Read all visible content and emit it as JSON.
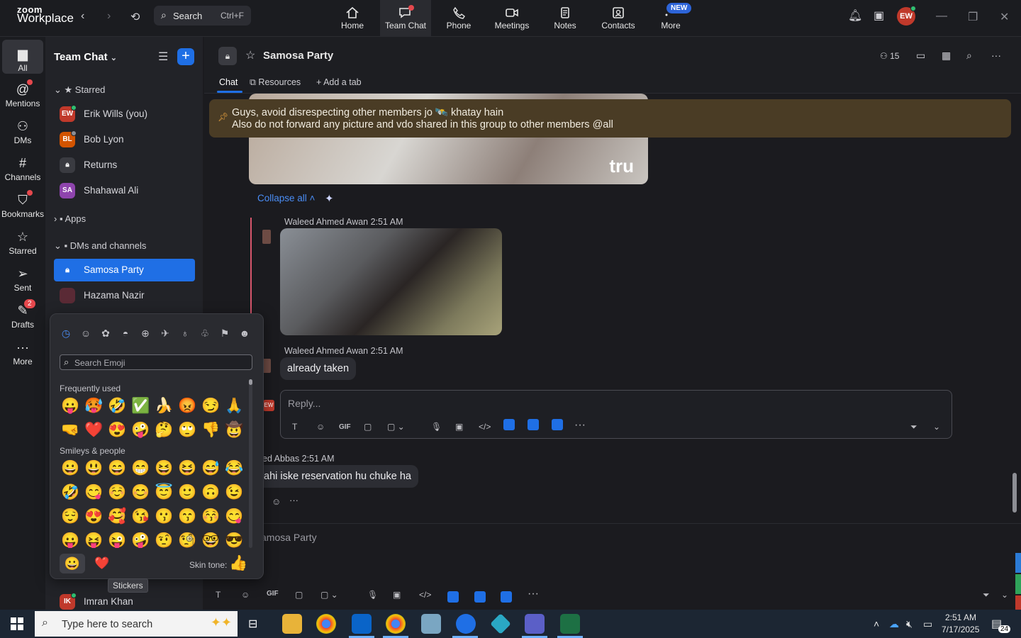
{
  "app": {
    "logo_top": "zoom",
    "logo_bottom": "Workplace",
    "search_label": "Search",
    "search_shortcut": "Ctrl+F",
    "nav": [
      "Home",
      "Team Chat",
      "Phone",
      "Meetings",
      "Notes",
      "Contacts",
      "More"
    ],
    "new_badge": "NEW",
    "avatar_initials": "EW"
  },
  "rail": {
    "items": [
      "All",
      "Mentions",
      "DMs",
      "Channels",
      "Bookmarks",
      "Starred",
      "Sent",
      "Drafts",
      "More"
    ],
    "drafts_badge": "2"
  },
  "sidebar": {
    "title": "Team Chat",
    "sections": {
      "starred": "Starred",
      "apps": "Apps",
      "dms": "DMs and channels"
    },
    "starred": [
      {
        "initials": "EW",
        "name": "Erik Wills (you)",
        "color": "#c0392b"
      },
      {
        "initials": "BL",
        "name": "Bob Lyon",
        "color": "#d35400"
      },
      {
        "initials": "",
        "name": "Returns",
        "color": "#3a3b41"
      },
      {
        "initials": "SA",
        "name": "Shahawal Ali",
        "color": "#8e44ad"
      }
    ],
    "channels": [
      {
        "name": "Samosa Party",
        "selected": true
      },
      {
        "name": "Hazama Nazir"
      }
    ],
    "bottom_contact": {
      "initials": "IK",
      "name": "Imran Khan",
      "color": "#c0392b"
    }
  },
  "channel": {
    "name": "Samosa Party",
    "members": "15",
    "tabs": [
      "Chat",
      "Resources",
      "Add a tab"
    ]
  },
  "chat": {
    "pinned_line1": "Guys, avoid disrespecting other members jo 🛰️ khatay hain",
    "pinned_line2": "Also do not forward any picture and vdo shared in this group to other members @all",
    "image_watermark": "tru",
    "collapse_all": "Collapse all",
    "messages": [
      {
        "author": "Waleed Ahmed Awan",
        "time": "2:51 AM"
      },
      {
        "author": "Waleed Ahmed Awan",
        "time": "2:51 AM",
        "text": "already taken"
      },
      {
        "author": "ed Abbas",
        "time": "2:51 AM",
        "text": "ahi iske reservation hu chuke ha"
      }
    ],
    "reply_placeholder": "Reply...",
    "composer_placeholder": "amosa Party",
    "reply_avatar": "EW"
  },
  "emoji_picker": {
    "search_placeholder": "Search Emoji",
    "frequently_used_label": "Frequently used",
    "smileys_label": "Smileys & people",
    "frequently_used": [
      "😛",
      "🥵",
      "🤣",
      "✅",
      "🍌",
      "😡",
      "😏",
      "🙏",
      "🤜",
      "❤️",
      "😍",
      "🤪",
      "🤔",
      "🙄",
      "👎",
      "🤠"
    ],
    "smileys": [
      "😀",
      "😃",
      "😄",
      "😁",
      "😆",
      "😆",
      "😅",
      "😂",
      "🤣",
      "😋",
      "☺️",
      "😊",
      "😇",
      "🙂",
      "🙃",
      "😉",
      "😌",
      "😍",
      "🥰",
      "😘",
      "😗",
      "😙",
      "😚",
      "😋",
      "😛",
      "😝",
      "😜",
      "🤪",
      "🤨",
      "🧐",
      "🤓",
      "😎"
    ],
    "skin_tone_label": "Skin tone:",
    "skin_tone_emoji": "👍",
    "footer_emoji": "😀",
    "footer_heart": "❤️",
    "tooltip": "Stickers"
  },
  "taskbar": {
    "search_placeholder": "Type here to search",
    "time": "2:51 AM",
    "date": "7/17/2025",
    "notif_count": "24"
  }
}
